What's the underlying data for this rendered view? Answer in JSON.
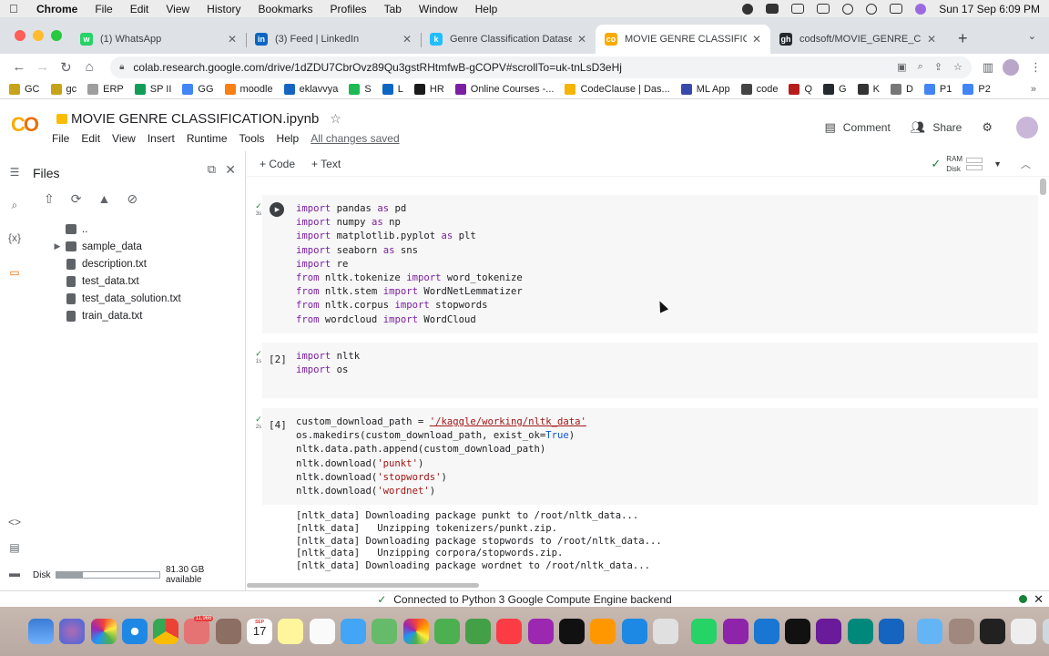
{
  "menubar": {
    "app": "Chrome",
    "items": [
      "File",
      "Edit",
      "View",
      "History",
      "Bookmarks",
      "Profiles",
      "Tab",
      "Window",
      "Help"
    ],
    "datetime": "Sun 17 Sep  6:09 PM"
  },
  "tabs": [
    {
      "title": "(1) WhatsApp",
      "color": "#25d366",
      "glyph": "w"
    },
    {
      "title": "(3) Feed | LinkedIn",
      "color": "#0a66c2",
      "glyph": "in"
    },
    {
      "title": "Genre Classification Dataset IM",
      "color": "#20beff",
      "glyph": "k"
    },
    {
      "title": "MOVIE GENRE CLASSIFICATIO",
      "color": "#f9ab00",
      "glyph": "co"
    },
    {
      "title": "codsoft/MOVIE_GENRE_CLASSI",
      "color": "#24292f",
      "glyph": "gh"
    }
  ],
  "address": {
    "url": "colab.research.google.com/drive/1dZDU7CbrOvz89Qu3gstRHtmfwB-gCOPV#scrollTo=uk-tnLsD3eHj"
  },
  "bookmarks": [
    {
      "label": "GC",
      "color": "#c8a31a"
    },
    {
      "label": "gc",
      "color": "#c8a31a"
    },
    {
      "label": "ERP",
      "color": "#9e9e9e"
    },
    {
      "label": "SP II",
      "color": "#0f9d58"
    },
    {
      "label": "GG",
      "color": "#4285f4"
    },
    {
      "label": "moodle",
      "color": "#f98012"
    },
    {
      "label": "eklavvya",
      "color": "#1565c0"
    },
    {
      "label": "S",
      "color": "#1db954"
    },
    {
      "label": "L",
      "color": "#0a66c2"
    },
    {
      "label": "HR",
      "color": "#1a1a1a"
    },
    {
      "label": "Online Courses -...",
      "color": "#7b1fa2"
    },
    {
      "label": "CodeClause | Das...",
      "color": "#f4b400"
    },
    {
      "label": "ML App",
      "color": "#3949ab"
    },
    {
      "label": "code",
      "color": "#444444"
    },
    {
      "label": "Q",
      "color": "#b71c1c"
    },
    {
      "label": "G",
      "color": "#24292f"
    },
    {
      "label": "K",
      "color": "#333333"
    },
    {
      "label": "D",
      "color": "#777777"
    },
    {
      "label": "P1",
      "color": "#4285f4"
    },
    {
      "label": "P2",
      "color": "#4285f4"
    }
  ],
  "colab": {
    "title": "MOVIE GENRE CLASSIFICATION.ipynb",
    "menu": [
      "File",
      "Edit",
      "View",
      "Insert",
      "Runtime",
      "Tools",
      "Help"
    ],
    "saved": "All changes saved",
    "comment": "Comment",
    "share": "Share",
    "add_code": "+ Code",
    "add_text": "+ Text",
    "ram": "RAM",
    "disk": "Disk"
  },
  "files": {
    "title": "Files",
    "tree": [
      {
        "name": "..",
        "type": "folder"
      },
      {
        "name": "sample_data",
        "type": "folder"
      },
      {
        "name": "description.txt",
        "type": "file"
      },
      {
        "name": "test_data.txt",
        "type": "file"
      },
      {
        "name": "test_data_solution.txt",
        "type": "file"
      },
      {
        "name": "train_data.txt",
        "type": "file"
      }
    ],
    "disk_label": "Disk",
    "disk_available": "81.30 GB available",
    "disk_used_fraction": 0.25
  },
  "cells": [
    {
      "exec": "",
      "time": "3s"
    },
    {
      "exec": "[2]",
      "time": "1s"
    },
    {
      "exec": "[4]",
      "time": "2s"
    }
  ],
  "status": {
    "message": "Connected to Python 3 Google Compute Engine backend"
  }
}
